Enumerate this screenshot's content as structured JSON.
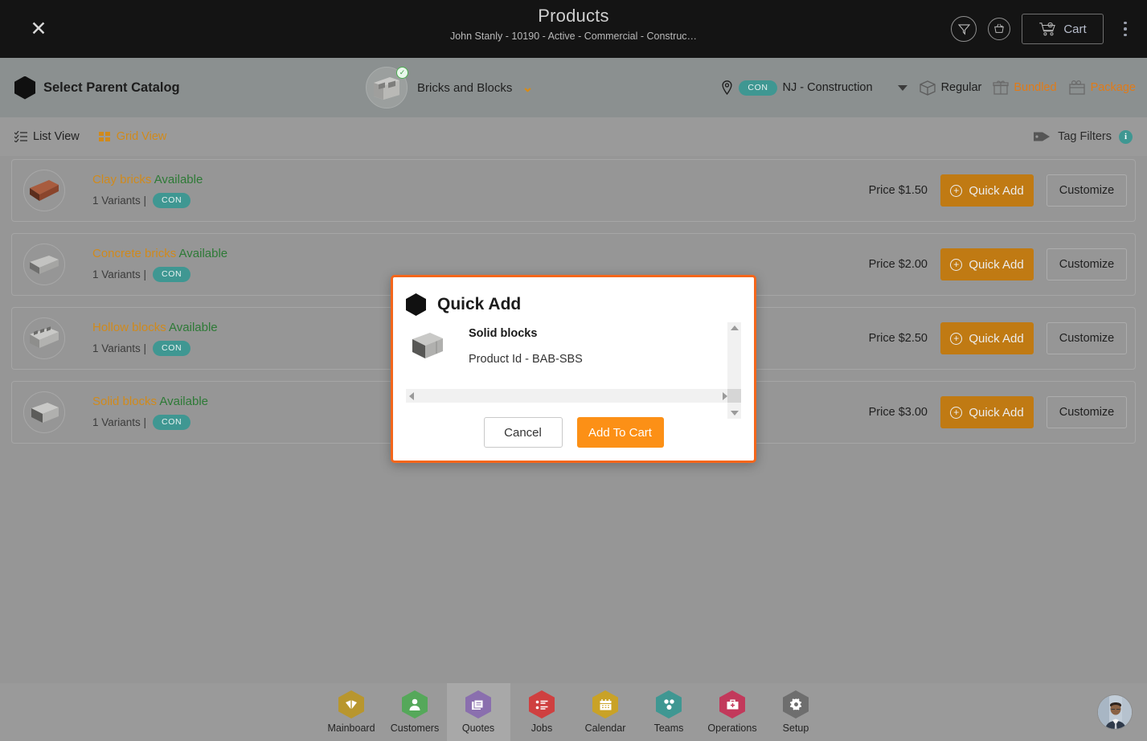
{
  "header": {
    "close_icon": "close-icon",
    "title": "Products",
    "subtitle": "John Stanly - 10190 - Active - Commercial - Construc…",
    "filter_icon": "filter-funnel-icon",
    "basket_icon": "basket-add-icon",
    "cart_label": "Cart",
    "cart_icon": "shopping-cart-icon",
    "more_icon": "more-vertical-icon"
  },
  "catalog_bar": {
    "hex_icon": "hexagon-icon",
    "select_parent_label": "Select Parent Catalog",
    "selected_catalog": "Bricks and Blocks",
    "catalog_thumb": "concrete-blocks-thumbnail",
    "check_badge": "✓",
    "location_icon": "location-pin-icon",
    "location_badge": "CON",
    "location_name": "NJ - Construction",
    "types": [
      {
        "label": "Regular",
        "icon": "box-icon",
        "style": "dark"
      },
      {
        "label": "Bundled",
        "icon": "gift-icon",
        "style": "orange"
      },
      {
        "label": "Package",
        "icon": "package-icon",
        "style": "orange"
      }
    ]
  },
  "view_bar": {
    "list_view_label": "List View",
    "list_view_icon": "list-view-icon",
    "grid_view_label": "Grid View",
    "grid_view_icon": "grid-view-icon",
    "tag_filters_label": "Tag Filters",
    "tag_icon": "tag-icon",
    "info_icon": "i"
  },
  "products": [
    {
      "name": "Clay bricks",
      "availability": "Available",
      "variants": "1 Variants |",
      "badge": "CON",
      "price": "Price $1.50",
      "quick_add": "Quick Add",
      "customize": "Customize",
      "thumb": "clay-brick-thumbnail"
    },
    {
      "name": "Concrete bricks",
      "availability": "Available",
      "variants": "1 Variants |",
      "badge": "CON",
      "price": "Price $2.00",
      "quick_add": "Quick Add",
      "customize": "Customize",
      "thumb": "concrete-brick-thumbnail"
    },
    {
      "name": "Hollow blocks",
      "availability": "Available",
      "variants": "1 Variants |",
      "badge": "CON",
      "price": "Price $2.50",
      "quick_add": "Quick Add",
      "customize": "Customize",
      "thumb": "hollow-block-thumbnail"
    },
    {
      "name": "Solid blocks",
      "availability": "Available",
      "variants": "1 Variants |",
      "badge": "CON",
      "price": "Price $3.00",
      "quick_add": "Quick Add",
      "customize": "Customize",
      "thumb": "solid-block-thumbnail"
    }
  ],
  "modal": {
    "hex_icon": "hexagon-icon",
    "title": "Quick Add",
    "product_name": "Solid blocks",
    "product_id": "Product Id - BAB-SBS",
    "product_thumb": "solid-block-thumbnail",
    "cancel_label": "Cancel",
    "add_to_cart_label": "Add To Cart",
    "border_color": "#f4661b",
    "add_to_cart_color": "#fc9016"
  },
  "bottom_nav": {
    "items": [
      {
        "label": "Mainboard",
        "icon": "mainboard-icon",
        "color": "#b8962e",
        "glyph": "◣",
        "active": false
      },
      {
        "label": "Customers",
        "icon": "customers-icon",
        "color": "#55a85a",
        "glyph": "♟",
        "active": false
      },
      {
        "label": "Quotes",
        "icon": "quotes-icon",
        "color": "#8a6fae",
        "glyph": "❐",
        "active": true
      },
      {
        "label": "Jobs",
        "icon": "jobs-icon",
        "color": "#cf4040",
        "glyph": "☰",
        "active": false
      },
      {
        "label": "Calendar",
        "icon": "calendar-icon",
        "color": "#c9a227",
        "glyph": "▦",
        "active": false
      },
      {
        "label": "Teams",
        "icon": "teams-icon",
        "color": "#3f9792",
        "glyph": "∴",
        "active": false
      },
      {
        "label": "Operations",
        "icon": "operations-icon",
        "color": "#c2395b",
        "glyph": "▬",
        "active": false
      },
      {
        "label": "Setup",
        "icon": "setup-icon",
        "color": "#6e6e6e",
        "glyph": "⚙",
        "active": false
      }
    ],
    "avatar": "user-avatar"
  }
}
